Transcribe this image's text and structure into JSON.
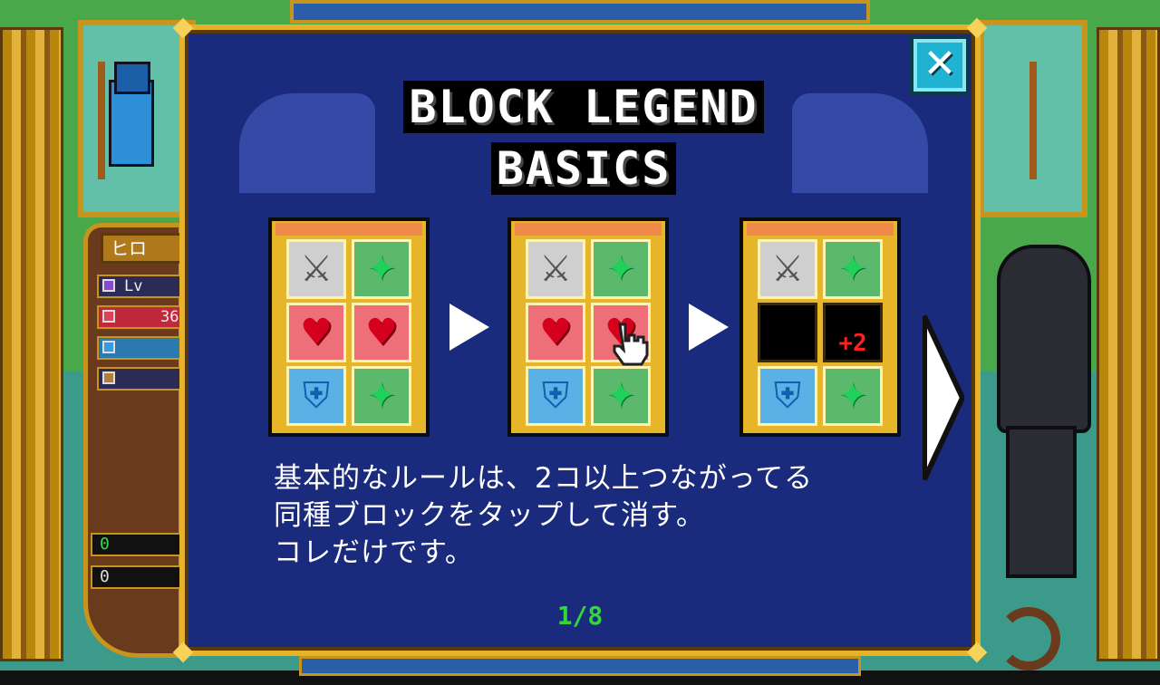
{
  "background": {
    "status_panel": {
      "name": "ヒロ",
      "level_label": "Lv",
      "hp_value": "36",
      "counter_1": "0",
      "counter_2": "0"
    }
  },
  "modal": {
    "title_line_1": "BLOCK LEGEND",
    "title_line_2": "BASICS",
    "close_label": "✕",
    "description_lines": [
      "基本的なルールは、2コ以上つながってる",
      "同種ブロックをタップして消す。",
      "コレだけです。"
    ],
    "page_indicator": "1/8",
    "bonus_text": "+2",
    "steps": [
      {
        "tiles": [
          "sword",
          "gem",
          "heart",
          "heart",
          "shield",
          "gem"
        ]
      },
      {
        "tiles": [
          "sword",
          "gem",
          "heart",
          "heart",
          "shield",
          "gem"
        ],
        "pointer": "hand-cursor-icon"
      },
      {
        "tiles": [
          "sword",
          "gem",
          "empty",
          "empty",
          "shield",
          "gem"
        ]
      }
    ]
  },
  "colors": {
    "modal_bg": "#1a2a7c",
    "modal_border": "#e8b12a",
    "page_indicator": "#30d83a",
    "bonus": "#ff2020",
    "close_button": "#1fb3d1"
  }
}
